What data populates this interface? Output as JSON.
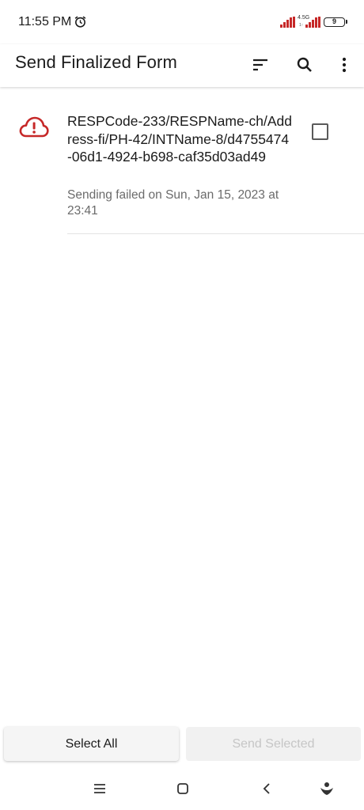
{
  "status_bar": {
    "time": "11:55 PM",
    "network": "4.5G",
    "network_sub": "1↑",
    "battery": "9"
  },
  "app_bar": {
    "title": "Send Finalized Form",
    "actions": [
      "sort-icon",
      "search-icon",
      "more-vert-icon"
    ]
  },
  "forms": [
    {
      "title": "RESPCode-233/RESPName-ch/Address-fi/PH-42/INTName-8/d4755474-06d1-4924-b698-caf35d03ad49",
      "status": "Sending failed on Sun, Jan 15, 2023 at 23:41",
      "icon": "cloud-alert-icon",
      "checked": false
    }
  ],
  "bottom_buttons": {
    "select_all": "Select All",
    "send_selected": "Send Selected"
  },
  "nav_bar": [
    "menu-icon",
    "home-icon",
    "back-icon",
    "assistant-icon"
  ],
  "colors": {
    "error": "#c62828",
    "text_primary": "#1b1b1b",
    "text_secondary": "#6b6b6b",
    "disabled_text": "#c6c6c6"
  }
}
